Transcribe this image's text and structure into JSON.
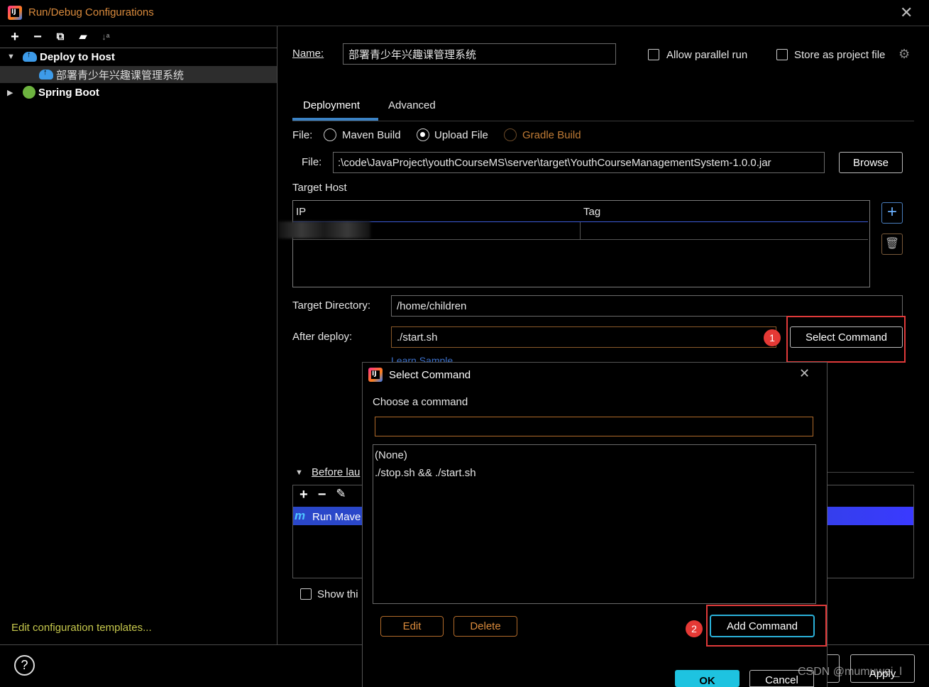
{
  "window": {
    "title": "Run/Debug Configurations"
  },
  "tree": {
    "items": [
      {
        "label": "Deploy to Host"
      },
      {
        "label": "部署青少年兴趣课管理系统"
      },
      {
        "label": "Spring Boot"
      }
    ],
    "edit_templates": "Edit configuration templates..."
  },
  "form": {
    "name_label": "Name:",
    "name_value": "部署青少年兴趣课管理系统",
    "allow_parallel": "Allow parallel run",
    "store_project": "Store as project file",
    "tabs": [
      "Deployment",
      "Advanced"
    ],
    "file_label": "File:",
    "file_options": [
      "Maven Build",
      "Upload File",
      "Gradle Build"
    ],
    "file_path_label": "File:",
    "file_path": ":\\code\\JavaProject\\youthCourseMS\\server\\target\\YouthCourseManagementSystem-1.0.0.jar",
    "browse": "Browse",
    "target_host": "Target Host",
    "col_ip": "IP",
    "col_tag": "Tag",
    "target_dir_label": "Target Directory:",
    "target_dir": "/home/children",
    "after_deploy_label": "After deploy:",
    "after_deploy": "./start.sh",
    "select_command": "Select Command",
    "learn_sample": "Learn Sample",
    "before_launch": "Before lau",
    "run_maven": "Run Mave",
    "show_this": "Show thi"
  },
  "badges": [
    "1",
    "2"
  ],
  "dialog": {
    "title": "Select Command",
    "prompt": "Choose a command",
    "search_value": "",
    "commands": [
      "(None)",
      "./stop.sh && ./start.sh"
    ],
    "edit": "Edit",
    "delete": "Delete",
    "add_command": "Add Command",
    "ok": "OK",
    "cancel": "Cancel"
  },
  "footer": {
    "help": "?",
    "apply": "Apply",
    "watermark": "CSDN @mumuwei_l"
  }
}
